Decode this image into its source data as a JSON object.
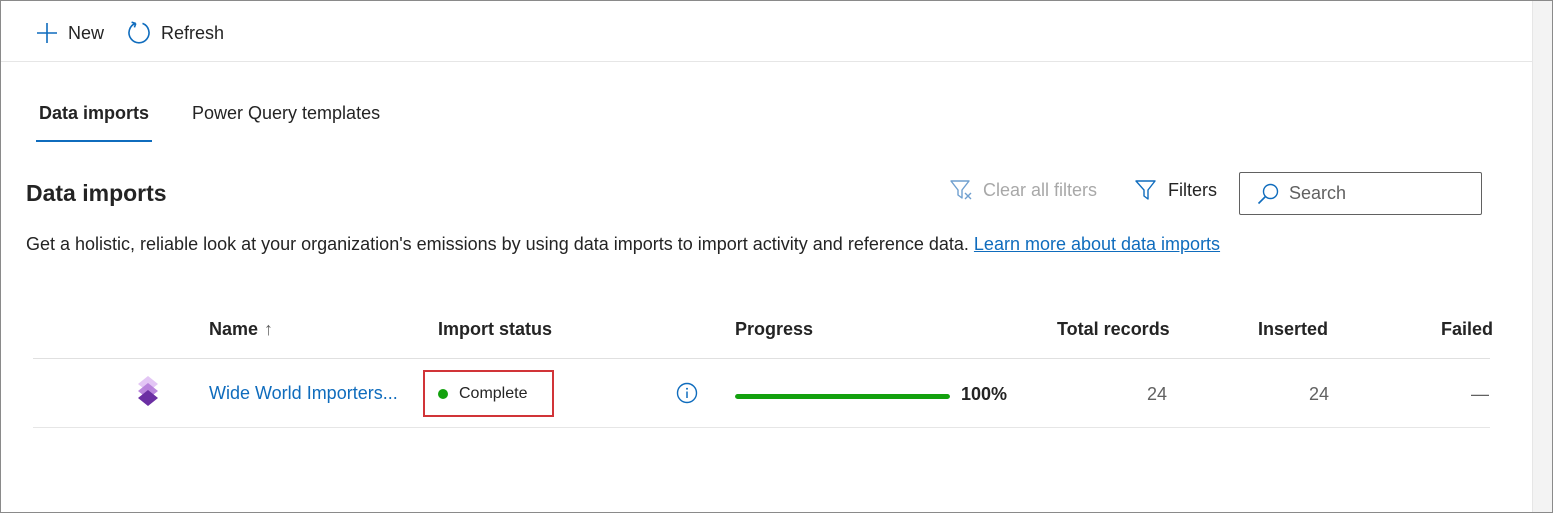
{
  "toolbar": {
    "new_label": "New",
    "refresh_label": "Refresh",
    "new_icon": "plus-icon",
    "refresh_icon": "refresh-icon"
  },
  "tabs": [
    {
      "label": "Data imports",
      "active": true
    },
    {
      "label": "Power Query templates",
      "active": false
    }
  ],
  "section": {
    "title": "Data imports",
    "clear_filters_label": "Clear all filters",
    "filters_label": "Filters",
    "search_placeholder": "Search",
    "description": "Get a holistic, reliable look at your organization's emissions by using data imports to import activity and reference data.",
    "learn_more_link": "Learn more about data imports"
  },
  "grid": {
    "columns": {
      "name": "Name",
      "sort_indicator": "↑",
      "import_status": "Import status",
      "progress": "Progress",
      "total_records": "Total records",
      "inserted": "Inserted",
      "failed": "Failed"
    },
    "rows": [
      {
        "name": "Wide World Importers...",
        "status": "Complete",
        "progress_percent": 100,
        "progress_text": "100%",
        "total_records": "24",
        "inserted": "24",
        "failed": "—"
      }
    ]
  },
  "colors": {
    "accent": "#0f6cbd",
    "status_complete": "#13a10e",
    "highlight": "#d13438",
    "icon_purple": "#8a3ec4"
  }
}
